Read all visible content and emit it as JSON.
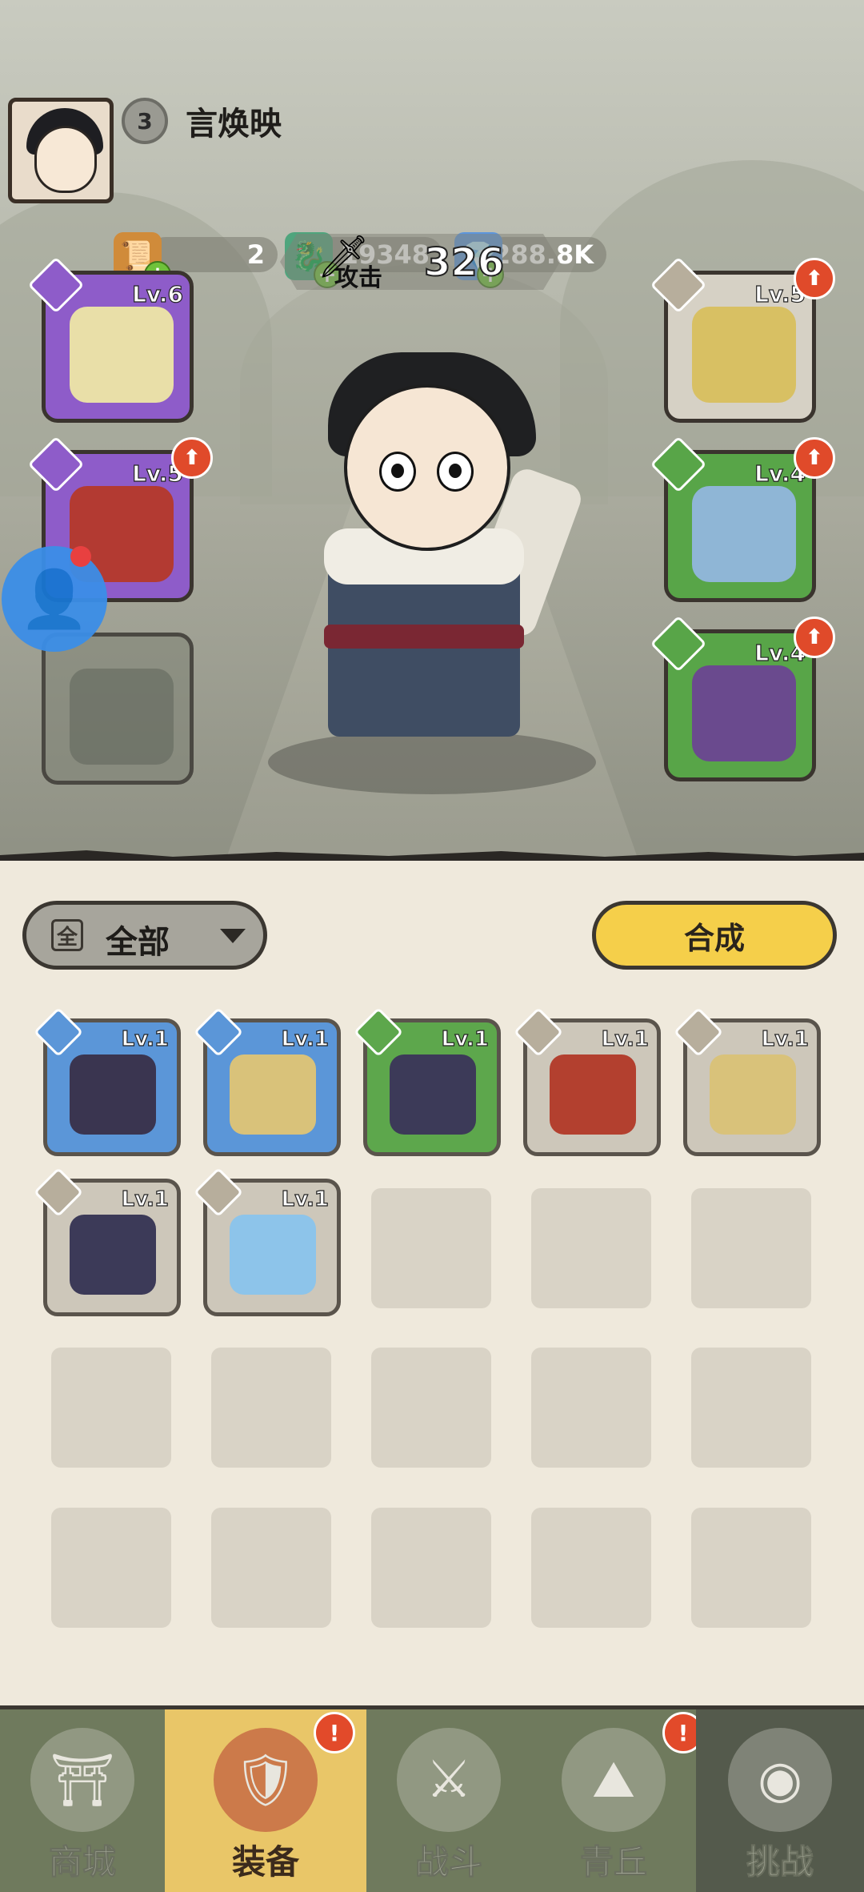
{
  "player": {
    "level": "3",
    "name": "言焕映"
  },
  "resources": [
    {
      "name": "scroll-ticket",
      "value": "2",
      "color": "#c9782f"
    },
    {
      "name": "jade-dragon",
      "value": "19348",
      "color": "#5bb08a"
    },
    {
      "name": "crystal",
      "value": "288.8K",
      "color": "#6aa6e8"
    }
  ],
  "attack": {
    "label": "攻击",
    "value": "326"
  },
  "equipped": {
    "weapon": {
      "level": "Lv.6"
    },
    "armor": {
      "level": "Lv.5"
    },
    "helmet": {
      "level": "Lv.5"
    },
    "boots": {
      "level": "Lv.4"
    },
    "amulet": {
      "level": "Lv.4"
    }
  },
  "filter": {
    "icon_char": "全",
    "label": "全部"
  },
  "merge_button": "合成",
  "inventory": [
    {
      "level": "Lv.1",
      "rarity": "blue",
      "kind": "armor-dark"
    },
    {
      "level": "Lv.1",
      "rarity": "blue",
      "kind": "armor-gold"
    },
    {
      "level": "Lv.1",
      "rarity": "green",
      "kind": "boots-dark"
    },
    {
      "level": "Lv.1",
      "rarity": "grey",
      "kind": "armor-red"
    },
    {
      "level": "Lv.1",
      "rarity": "grey",
      "kind": "armor-gold"
    },
    {
      "level": "Lv.1",
      "rarity": "grey",
      "kind": "boots-dark"
    },
    {
      "level": "Lv.1",
      "rarity": "grey",
      "kind": "amulet-blue"
    }
  ],
  "nav": [
    {
      "label": "商城"
    },
    {
      "label": "装备"
    },
    {
      "label": "战斗"
    },
    {
      "label": "青丘"
    },
    {
      "label": "挑战"
    }
  ]
}
